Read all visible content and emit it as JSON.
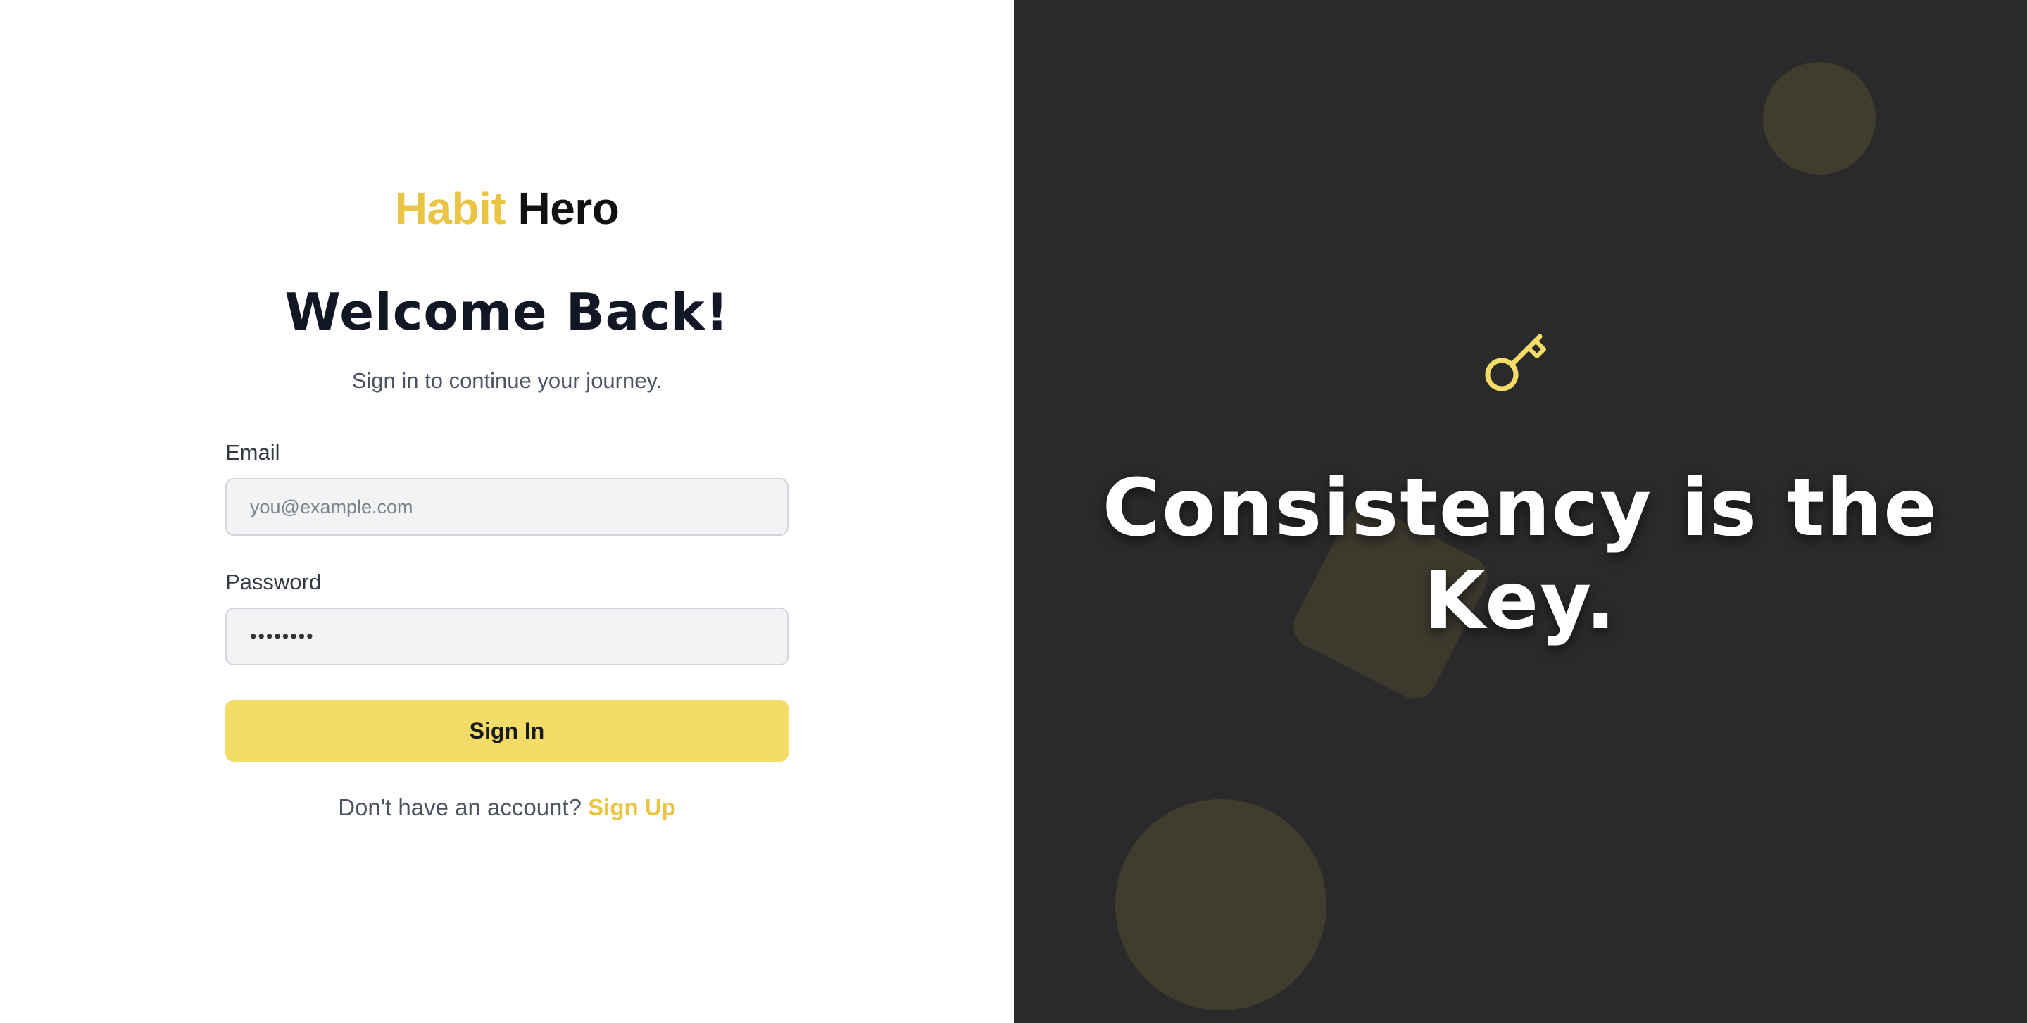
{
  "brand": {
    "word1": "Habit",
    "word2": "Hero",
    "accent_color": "#eac544"
  },
  "login": {
    "heading": "Welcome Back!",
    "subtitle": "Sign in to continue your journey.",
    "email_label": "Email",
    "email_placeholder": "you@example.com",
    "password_label": "Password",
    "password_value": "••••••••",
    "signin_label": "Sign In",
    "signup_prompt": "Don't have an account?",
    "signup_link": "Sign Up"
  },
  "promo": {
    "icon": "key-icon",
    "line1": "Consistency is the",
    "line2": "Key.",
    "background_color": "#2a2a2a",
    "icon_color": "#f3dd68"
  }
}
